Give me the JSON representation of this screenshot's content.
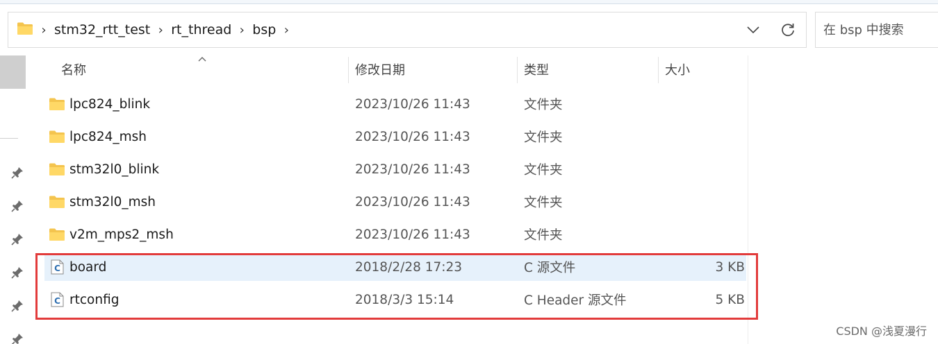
{
  "breadcrumb": [
    "stm32_rtt_test",
    "rt_thread",
    "bsp"
  ],
  "breadcrumb_separator": "›",
  "search": {
    "placeholder": "在 bsp 中搜索"
  },
  "columns": {
    "name": "名称",
    "date": "修改日期",
    "type": "类型",
    "size": "大小"
  },
  "files": [
    {
      "icon": "folder-icon",
      "name": "lpc824_blink",
      "date": "2023/10/26 11:43",
      "type": "文件夹",
      "size": ""
    },
    {
      "icon": "folder-icon",
      "name": "lpc824_msh",
      "date": "2023/10/26 11:43",
      "type": "文件夹",
      "size": ""
    },
    {
      "icon": "folder-icon",
      "name": "stm32l0_blink",
      "date": "2023/10/26 11:43",
      "type": "文件夹",
      "size": ""
    },
    {
      "icon": "folder-icon",
      "name": "stm32l0_msh",
      "date": "2023/10/26 11:43",
      "type": "文件夹",
      "size": ""
    },
    {
      "icon": "folder-icon",
      "name": "v2m_mps2_msh",
      "date": "2023/10/26 11:43",
      "type": "文件夹",
      "size": ""
    },
    {
      "icon": "c-file-icon",
      "name": "board",
      "date": "2018/2/28 17:23",
      "type": "C 源文件",
      "size": "3 KB"
    },
    {
      "icon": "c-file-icon",
      "name": "rtconfig",
      "date": "2018/3/3 15:14",
      "type": "C Header 源文件",
      "size": "5 KB"
    }
  ],
  "highlight_color": "#e6f1fb",
  "annotation_box_color": "#e23b3b",
  "watermark": "CSDN @浅夏漫行"
}
